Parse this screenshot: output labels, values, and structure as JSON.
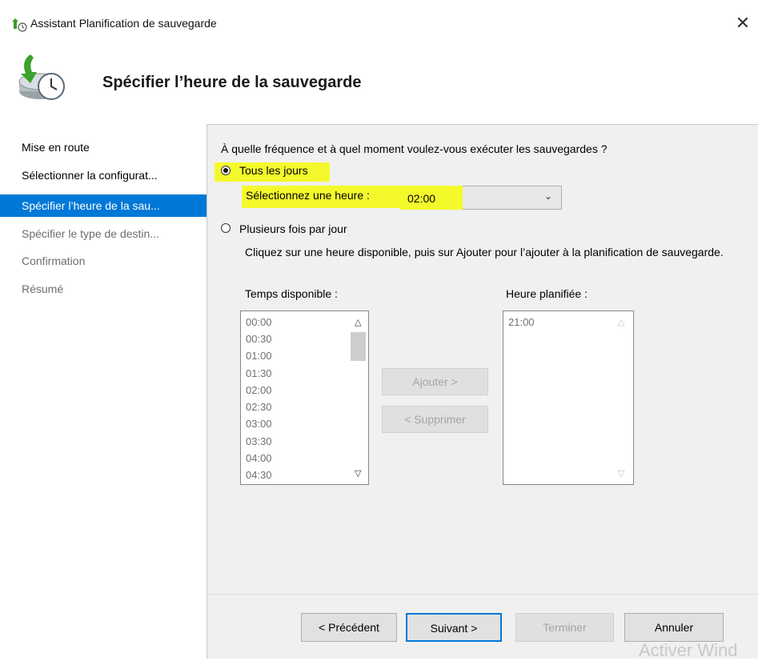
{
  "window": {
    "title": "Assistant Planification de sauvegarde",
    "close_glyph": "✕"
  },
  "header": {
    "title": "Spécifier l’heure de la sauvegarde"
  },
  "nav": {
    "items": [
      {
        "label": "Mise en route",
        "state": "normal"
      },
      {
        "label": "Sélectionner la configurat...",
        "state": "normal"
      },
      {
        "label": "Spécifier l’heure de la sau...",
        "state": "active"
      },
      {
        "label": "Spécifier le type de destin...",
        "state": "disabled"
      },
      {
        "label": "Confirmation",
        "state": "disabled"
      },
      {
        "label": "Résumé",
        "state": "disabled"
      }
    ]
  },
  "main": {
    "question": "À quelle fréquence et à quel moment voulez-vous exécuter les sauvegardes ?",
    "option_daily": "Tous les jours",
    "time_label": "Sélectionnez une heure :",
    "time_value": "02:00",
    "option_multiple": "Plusieurs fois par jour",
    "instructions": "Cliquez sur une heure disponible, puis sur Ajouter pour l’ajouter à la planification de sauvegarde.",
    "available_label": "Temps disponible :",
    "scheduled_label": "Heure planifiée :",
    "available_times": [
      "00:00",
      "00:30",
      "01:00",
      "01:30",
      "02:00",
      "02:30",
      "03:00",
      "03:30",
      "04:00",
      "04:30"
    ],
    "scheduled_times": [
      "21:00"
    ],
    "add_button": "Ajouter >",
    "remove_button": "< Supprimer"
  },
  "footer": {
    "prev": "< Précédent",
    "next": "Suivant >",
    "finish": "Terminer",
    "cancel": "Annuler"
  },
  "watermark": "Activer Wind",
  "colors": {
    "accent": "#0078d7",
    "highlight": "#f4f92c",
    "panel": "#f0f0f0"
  }
}
